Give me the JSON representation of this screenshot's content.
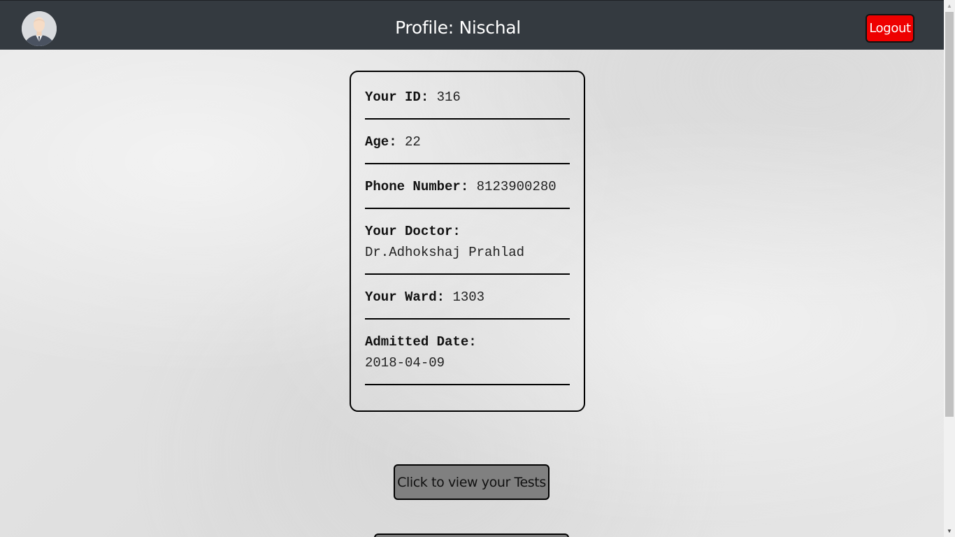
{
  "header": {
    "title": "Profile: Nischal",
    "logout_label": "Logout",
    "avatar_icon": "user-avatar-icon"
  },
  "profile": {
    "id": {
      "label": "Your ID:",
      "value": "316"
    },
    "age": {
      "label": "Age:",
      "value": "22"
    },
    "phone": {
      "label": "Phone Number:",
      "value": "8123900280"
    },
    "doctor": {
      "label": "Your Doctor:",
      "value": "Dr.Adhokshaj Prahlad"
    },
    "ward": {
      "label": "Your Ward:",
      "value": "1303"
    },
    "admitted": {
      "label": "Admitted Date:",
      "value": "2018-04-09"
    }
  },
  "actions": {
    "view_tests_label": "Click to view your Tests"
  },
  "colors": {
    "header_bg": "#343a40",
    "logout_bg": "#ee0000",
    "button_bg": "#808080"
  }
}
